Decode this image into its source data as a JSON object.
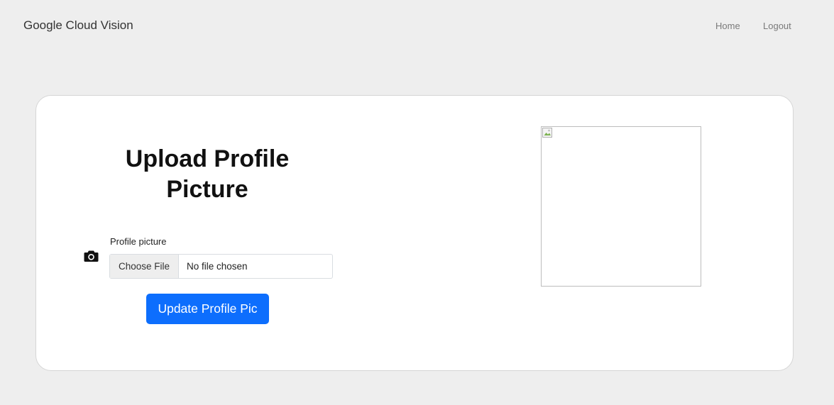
{
  "navbar": {
    "brand": "Google Cloud Vision",
    "links": [
      "Home",
      "Logout"
    ]
  },
  "upload_card": {
    "title": "Upload Profile Picture",
    "field_label": "Profile picture",
    "file_button": "Choose File",
    "file_status": "No file chosen",
    "submit_label": "Update Profile Pic",
    "icon": "camera-icon",
    "preview_icon": "broken-image-icon"
  },
  "colors": {
    "background": "#eeeeee",
    "primary": "#0d6efd",
    "card": "#ffffff"
  }
}
